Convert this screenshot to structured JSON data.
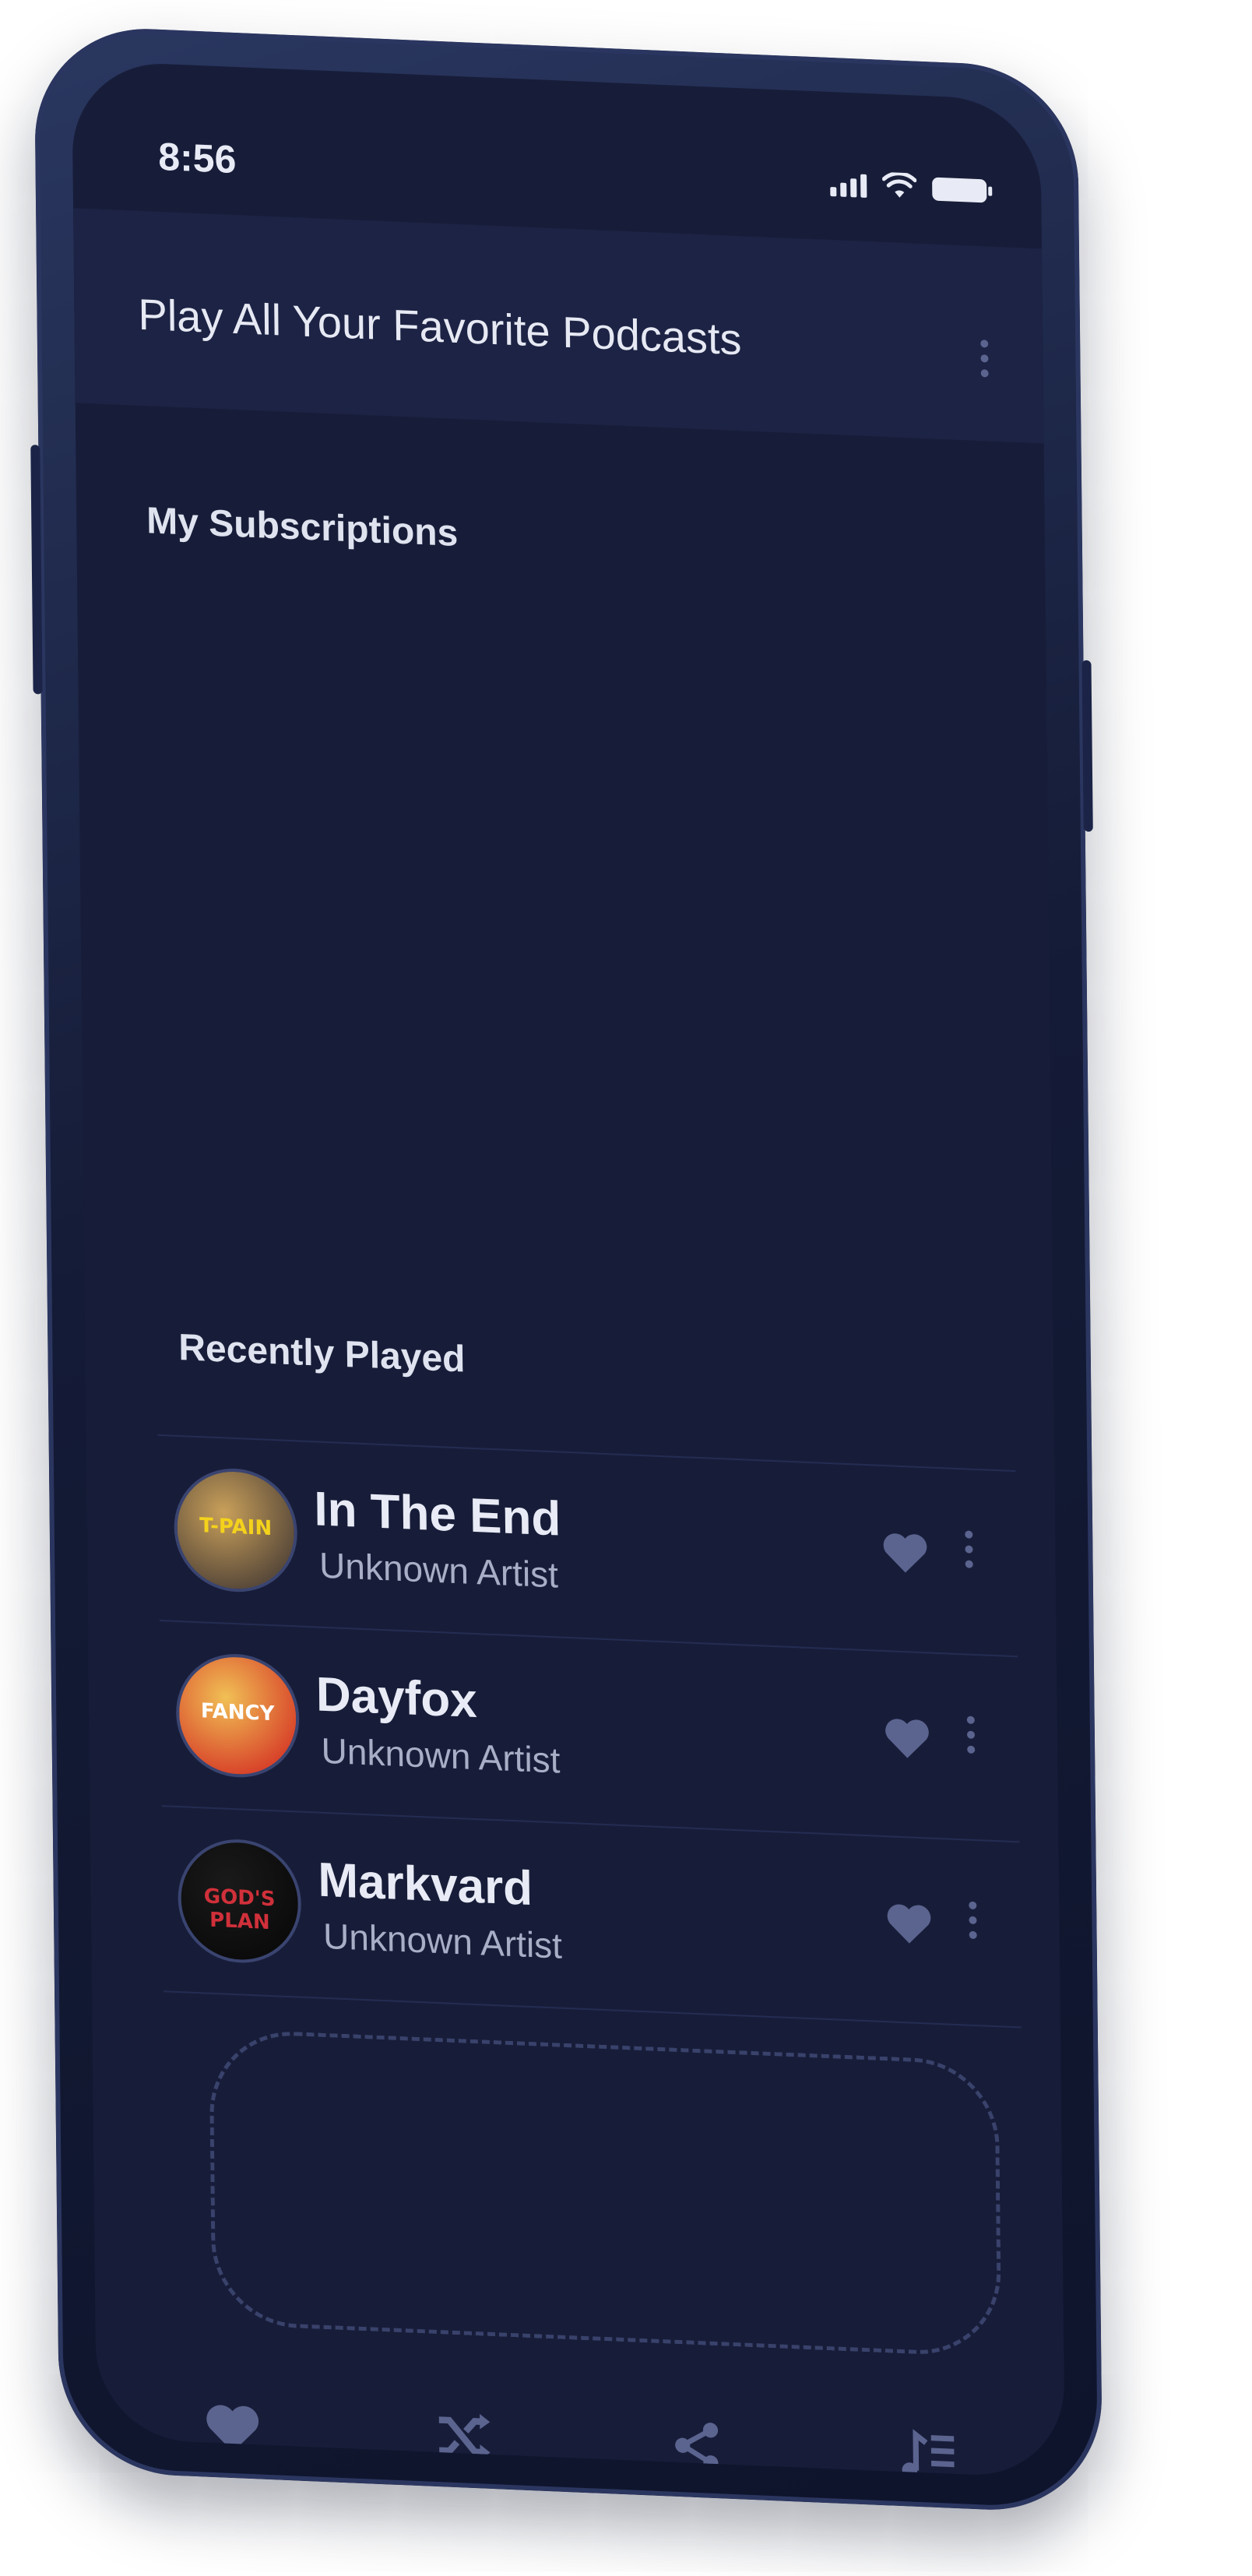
{
  "status_bar": {
    "time": "8:56"
  },
  "app_bar": {
    "title": "Play All Your Favorite Podcasts",
    "menu_icon": "vertical-dots-icon"
  },
  "sections": {
    "subscriptions_label": "My Subscriptions",
    "recent_label": "Recently Played"
  },
  "recently_played": [
    {
      "title": "In The End",
      "artist": "Unknown Artist",
      "cover_text": "T-PAIN",
      "cover_colors": [
        "#5a4a3a",
        "#c9a05a"
      ],
      "cover_text_color": "#f4d21c"
    },
    {
      "title": "Dayfox",
      "artist": "Unknown Artist",
      "cover_text": "FANCY",
      "cover_colors": [
        "#d8442a",
        "#f1c055"
      ],
      "cover_text_color": "#ffffff"
    },
    {
      "title": "Markvard",
      "artist": "Unknown Artist",
      "cover_text": "GOD'S PLAN",
      "cover_colors": [
        "#0b0b0b",
        "#1a1a1a"
      ],
      "cover_text_color": "#d0303a"
    }
  ],
  "bottom_nav": [
    {
      "icon": "heart-icon"
    },
    {
      "icon": "shuffle-icon"
    },
    {
      "icon": "share-icon"
    },
    {
      "icon": "playlist-icon"
    }
  ],
  "colors": {
    "background": "#171d39",
    "app_bar": "#1c2344",
    "accent_icon": "#5b648f",
    "text_primary": "#e8ebf5",
    "text_secondary": "#a8aec6"
  }
}
